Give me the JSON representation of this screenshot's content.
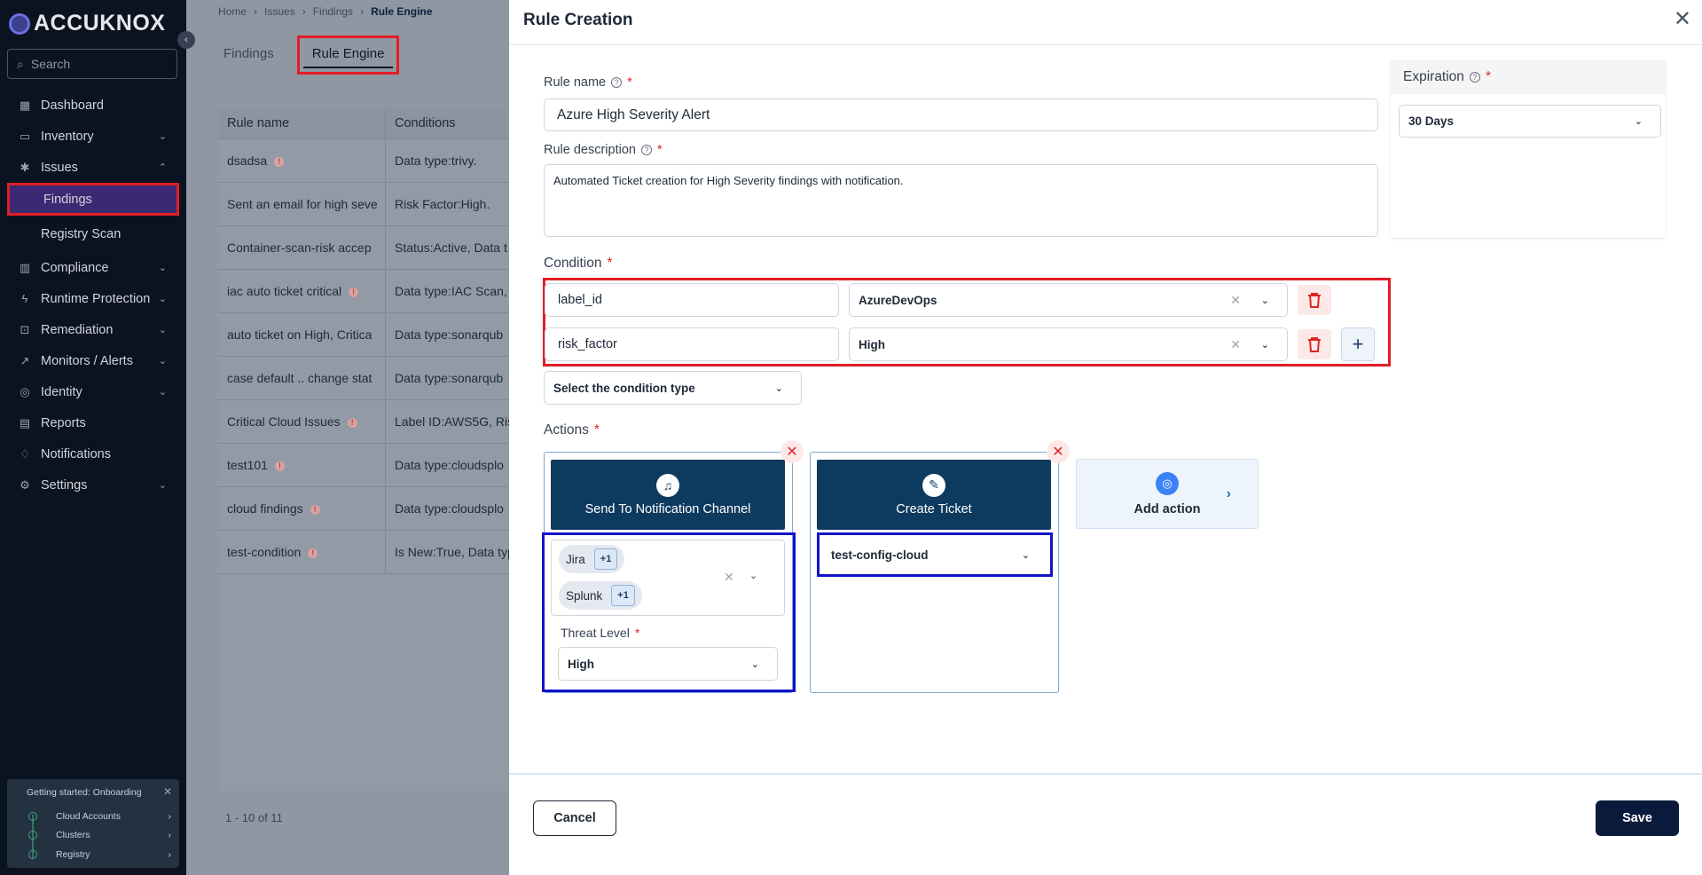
{
  "app": {
    "logo_text": "ACCUKNOX"
  },
  "sidebar": {
    "search_placeholder": "Search",
    "items": [
      {
        "label": "Dashboard",
        "icon": "grid-icon"
      },
      {
        "label": "Inventory",
        "icon": "monitor-icon"
      },
      {
        "label": "Issues",
        "icon": "bug-icon"
      },
      {
        "label": "Compliance",
        "icon": "chart-icon"
      },
      {
        "label": "Runtime Protection",
        "icon": "bolt-icon"
      },
      {
        "label": "Remediation",
        "icon": "lock-icon"
      },
      {
        "label": "Monitors / Alerts",
        "icon": "trend-icon"
      },
      {
        "label": "Identity",
        "icon": "fingerprint-icon"
      },
      {
        "label": "Reports",
        "icon": "report-icon"
      },
      {
        "label": "Notifications",
        "icon": "bell-icon"
      },
      {
        "label": "Settings",
        "icon": "gear-icon"
      }
    ],
    "sub_items": {
      "findings": "Findings",
      "registry_scan": "Registry Scan"
    },
    "onboarding": {
      "title": "Getting started: Onboarding",
      "steps": [
        "Cloud Accounts",
        "Clusters",
        "Registry"
      ]
    }
  },
  "breadcrumb": [
    "Home",
    "Issues",
    "Findings",
    "Rule Engine"
  ],
  "tabs": [
    "Findings",
    "Rule Engine"
  ],
  "table": {
    "headers": [
      "Rule name",
      "Conditions"
    ],
    "rows": [
      {
        "name": "dsadsa",
        "cond": "Data type:trivy.",
        "warn": true
      },
      {
        "name": "Sent an email for high seve",
        "cond": "Risk Factor:High.",
        "warn": false
      },
      {
        "name": "Container-scan-risk accep",
        "cond": "Status:Active, Data t",
        "warn": false
      },
      {
        "name": "iac auto ticket critical",
        "cond": "Data type:IAC Scan,",
        "warn": true
      },
      {
        "name": "auto ticket on High, Critica",
        "cond": "Data type:sonarqub",
        "warn": false
      },
      {
        "name": "case default .. change stat",
        "cond": "Data type:sonarqub",
        "warn": false
      },
      {
        "name": "Critical Cloud Issues",
        "cond": "Label ID:AWS5G, Risk",
        "warn": true
      },
      {
        "name": "test101",
        "cond": "Data type:cloudsplo",
        "warn": true
      },
      {
        "name": "cloud findings",
        "cond": "Data type:cloudsplo",
        "warn": true
      },
      {
        "name": "test-condition",
        "cond": "Is New:True, Data typ",
        "warn": true
      }
    ],
    "pager": "1 - 10 of 11"
  },
  "modal": {
    "title": "Rule Creation",
    "rule_name_label": "Rule name",
    "rule_name_value": "Azure High Severity Alert",
    "rule_desc_label": "Rule description",
    "rule_desc_value": "Automated Ticket creation for High Severity findings with notification.",
    "expiration_label": "Expiration",
    "expiration_value": "30 Days",
    "condition_label": "Condition",
    "conditions": [
      {
        "field": "label_id",
        "value": "AzureDevOps"
      },
      {
        "field": "risk_factor",
        "value": "High"
      }
    ],
    "condition_type_placeholder": "Select the condition type",
    "actions_label": "Actions",
    "actions": {
      "notify": {
        "title": "Send To Notification Channel",
        "chips": [
          {
            "label": "Jira",
            "more": "+1"
          },
          {
            "label": "Splunk",
            "more": "+1"
          }
        ],
        "threat_label": "Threat Level",
        "threat_value": "High"
      },
      "ticket": {
        "title": "Create Ticket",
        "value": "test-config-cloud"
      },
      "add": "Add action"
    },
    "cancel": "Cancel",
    "save": "Save"
  }
}
